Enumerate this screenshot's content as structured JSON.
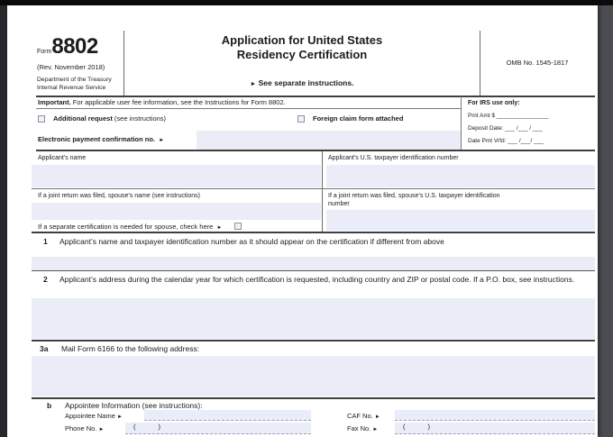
{
  "icons": {
    "arrow": "►"
  },
  "colors": {
    "field_fill": "#eaedf8",
    "page_bg": "#ffffff",
    "frame_bg": "#4a4d52",
    "rule_dark": "#3f3f3f"
  },
  "header": {
    "form_word": "Form",
    "form_number": "8802",
    "revision": "(Rev. November 2018)",
    "dept_line1": "Department of the Treasury",
    "dept_line2": "Internal Revenue Service",
    "title_line1": "Application for United States",
    "title_line2": "Residency Certification",
    "see_instructions": "See separate instructions.",
    "omb": "OMB No. 1545-1817"
  },
  "important": {
    "lead": "Important.",
    "rest": " For applicable user fee information, see the Instructions for Form 8802."
  },
  "irs_box": {
    "title": "For IRS use only:",
    "pmt_amt": "Pmt Amt $ ________________",
    "deposit_date": "Deposit Date: ___ /___ / ___",
    "date_pmt_vrfd": "Date Pmt Vrfd: ___ /___/ ___"
  },
  "options": {
    "additional_request": "Additional request",
    "additional_request_note": " (see instructions)",
    "foreign_claim": "Foreign claim form attached"
  },
  "electronic_payment_label": "Electronic payment confirmation no.",
  "applicant": {
    "name_label": "Applicant’s name",
    "tin_label": "Applicant’s U.S. taxpayer identification number",
    "spouse_name_label": "If a joint return was filed, spouse’s name (see instructions)",
    "spouse_tin_label": "If a joint return was filed, spouse’s U.S. taxpayer identification number",
    "separate_cert_label": "If a separate certification is needed for spouse, check here"
  },
  "line1": {
    "num": "1",
    "text": "Applicant’s name and taxpayer identification number as it should appear on the certification if different from above"
  },
  "line2": {
    "num": "2",
    "text": "Applicant’s address during the calendar year for which certification is requested, including country and ZIP or postal code. If a P.O. box, see instructions."
  },
  "line3a": {
    "num": "3a",
    "text": "Mail Form 6166 to the following address:"
  },
  "line3b": {
    "num": "b",
    "heading": "Appointee Information (see instructions):",
    "appointee_name": "Appointee Name",
    "caf_no": "CAF No.",
    "phone_no": "Phone No.",
    "fax_no": "Fax No.",
    "phone_parens": "(            )"
  }
}
